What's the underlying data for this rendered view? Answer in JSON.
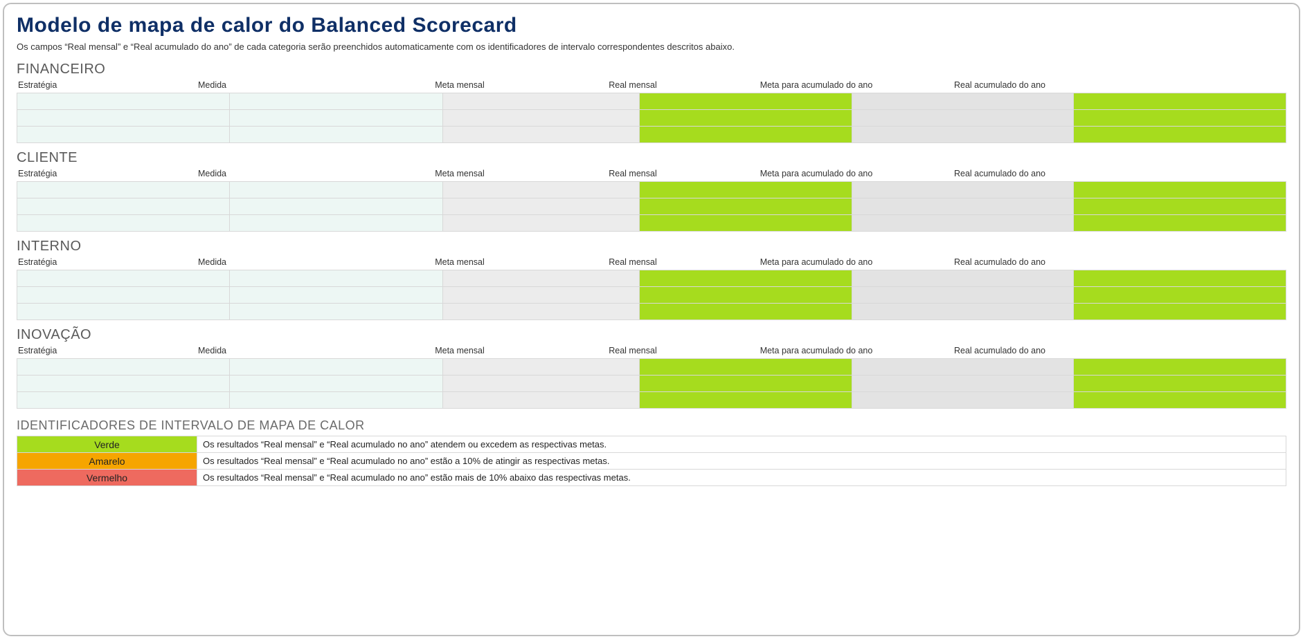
{
  "title": "Modelo de mapa de calor do Balanced Scorecard",
  "subtitle": "Os campos “Real mensal” e “Real acumulado do ano” de cada categoria serão preenchidos automaticamente com os identificadores de intervalo correspondentes descritos abaixo.",
  "columns": {
    "c1": "Estratégia",
    "c2": "Medida",
    "c3": "Meta mensal",
    "c4": "Real mensal",
    "c5": "Meta para acumulado do ano",
    "c6": "Real acumulado do ano"
  },
  "sections": {
    "s0": "FINANCEIRO",
    "s1": "CLIENTE",
    "s2": "INTERNO",
    "s3": "INOVAÇÃO"
  },
  "legend_title": "IDENTIFICADORES DE INTERVALO DE MAPA DE CALOR",
  "legend": {
    "green": {
      "label": "Verde",
      "desc": "Os resultados “Real mensal” e “Real acumulado no ano” atendem ou excedem as respectivas metas."
    },
    "yellow": {
      "label": "Amarelo",
      "desc": "Os resultados “Real mensal” e “Real acumulado no ano” estão a 10% de atingir as respectivas metas."
    },
    "red": {
      "label": "Vermelho",
      "desc": "Os resultados “Real mensal” e “Real acumulado no ano” estão mais de 10% abaixo das respectivas metas."
    }
  }
}
